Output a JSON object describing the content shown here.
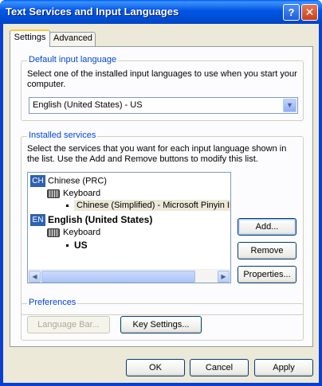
{
  "window": {
    "title": "Text Services and Input Languages",
    "help_glyph": "?",
    "close_glyph": "✕"
  },
  "tabs": [
    {
      "label": "Settings",
      "active": true
    },
    {
      "label": "Advanced",
      "active": false
    }
  ],
  "default_input_language": {
    "legend": "Default input language",
    "description": "Select one of the installed input languages to use when you start your computer.",
    "selected_value": "English (United States) - US"
  },
  "installed_services": {
    "legend": "Installed services",
    "description": "Select the services that you want for each input language shown in the list. Use the Add and Remove buttons to modify this list.",
    "tree": {
      "languages": [
        {
          "badge": "CH",
          "name": "Chinese (PRC)",
          "category": "Keyboard",
          "service": "Chinese (Simplified) - Microsoft Pinyin IM"
        },
        {
          "badge": "EN",
          "name": "English (United States)",
          "category": "Keyboard",
          "service": "US"
        }
      ]
    },
    "buttons": {
      "add": "Add...",
      "remove": "Remove",
      "properties": "Properties..."
    }
  },
  "preferences": {
    "legend": "Preferences",
    "language_bar": "Language Bar...",
    "key_settings": "Key Settings..."
  },
  "footer": {
    "ok": "OK",
    "cancel": "Cancel",
    "apply": "Apply"
  },
  "colors": {
    "titlebar": "#0055E5",
    "groupbox_legend": "#0046D5",
    "dialog_face": "#ECE9D8"
  }
}
